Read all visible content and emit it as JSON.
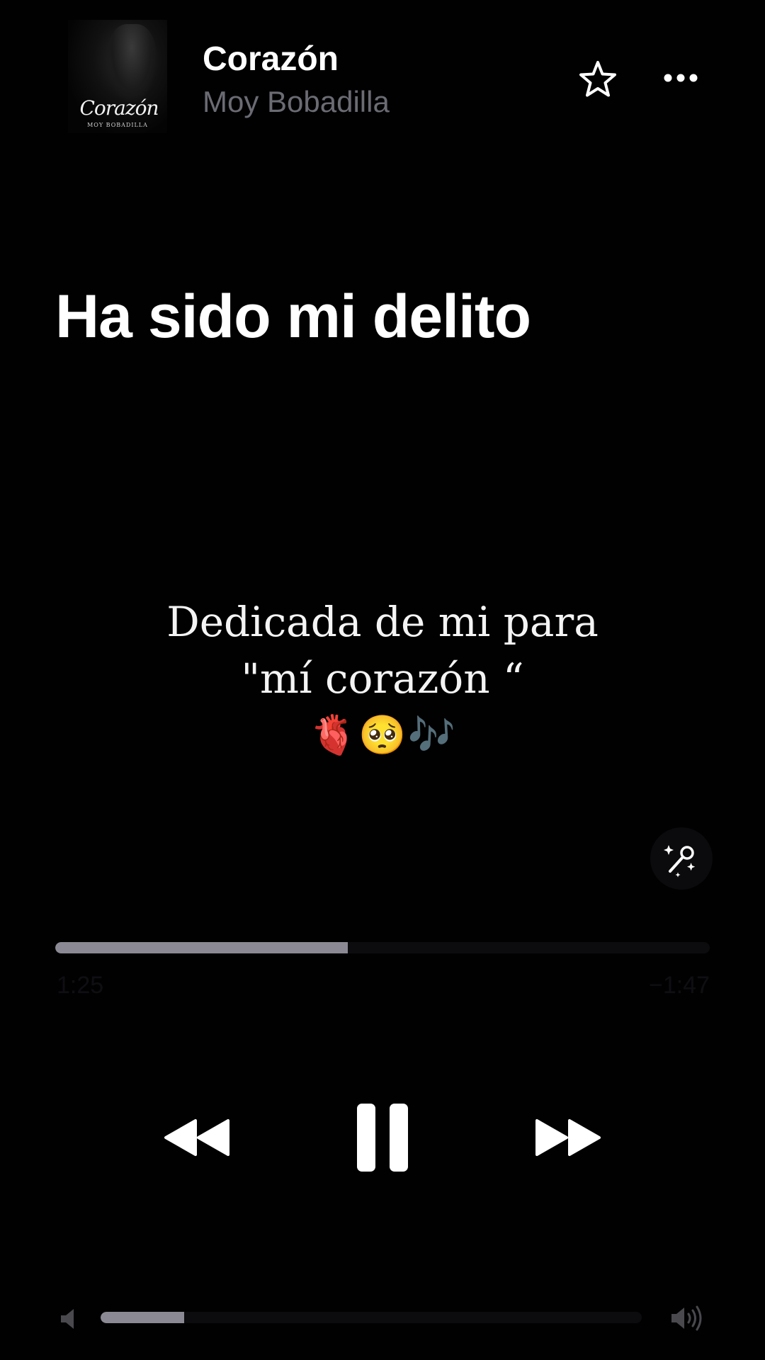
{
  "header": {
    "album_art": {
      "title_text": "Corazón",
      "artist_text": "MOY BOBADILLA"
    },
    "song_title": "Corazón",
    "artist": "Moy Bobadilla",
    "favorite_icon": "star-outline-icon",
    "more_icon": "ellipsis-icon"
  },
  "lyrics": {
    "active_line": "Ha sido mi delito"
  },
  "caption": {
    "line1": "Dedicada de mi para",
    "line2": "\"mí corazón “",
    "emoji_1": "🫀",
    "emoji_2": "🥺",
    "emoji_3": "🎶"
  },
  "sing_button": {
    "icon": "microphone-sparkle-icon"
  },
  "playback": {
    "elapsed": "1:25",
    "remaining": "−1:47",
    "progress_fraction": 0.447
  },
  "controls": {
    "rewind_icon": "rewind-icon",
    "pause_icon": "pause-icon",
    "forward_icon": "fast-forward-icon"
  },
  "volume": {
    "level_fraction": 0.155,
    "low_icon": "speaker-low-icon",
    "high_icon": "speaker-high-icon"
  },
  "colors": {
    "background": "#020102",
    "secondary_text": "#6b6b74",
    "progress_fill": "#8b8a94"
  }
}
